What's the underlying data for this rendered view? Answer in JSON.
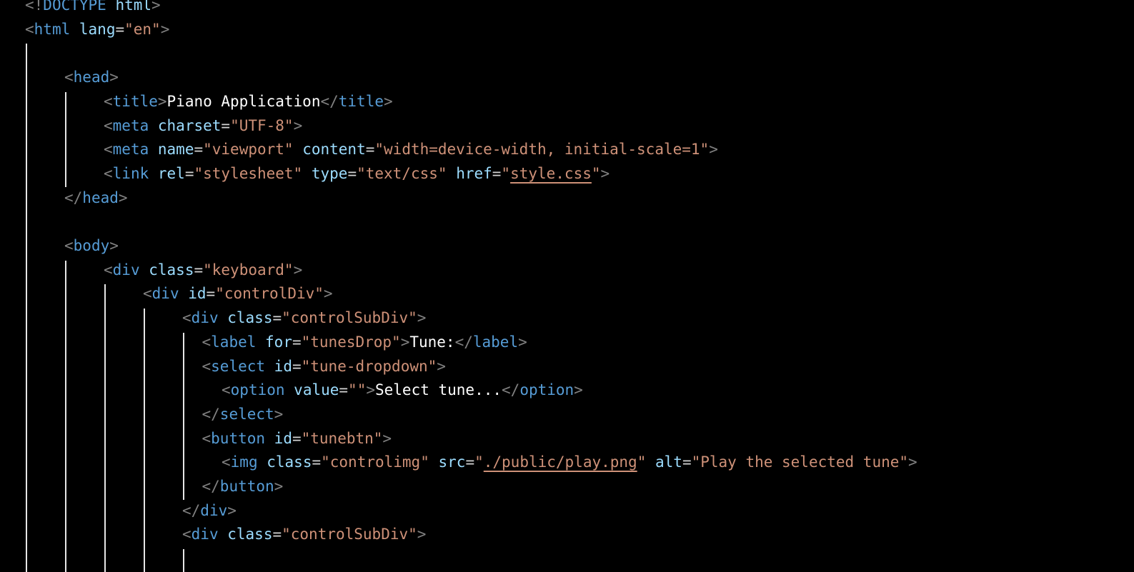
{
  "editor": {
    "theme": {
      "background": "#000000",
      "bracket": "#808080",
      "tag": "#569cd6",
      "attribute": "#9cdcfe",
      "string": "#ce9178",
      "text": "#ffffff"
    },
    "lines": [
      {
        "indent": 0,
        "tokens": [
          [
            "bracket",
            "<!"
          ],
          [
            "tag",
            "DOCTYPE"
          ],
          [
            "text",
            " "
          ],
          [
            "attr",
            "html"
          ],
          [
            "bracket",
            ">"
          ]
        ]
      },
      {
        "indent": 0,
        "tokens": [
          [
            "bracket",
            "<"
          ],
          [
            "tag",
            "html"
          ],
          [
            "text",
            " "
          ],
          [
            "attr",
            "lang"
          ],
          [
            "eq",
            "="
          ],
          [
            "str",
            "\"en\""
          ],
          [
            "bracket",
            ">"
          ]
        ]
      },
      {
        "indent": 0,
        "tokens": []
      },
      {
        "indent": 1,
        "tokens": [
          [
            "bracket",
            "<"
          ],
          [
            "tag",
            "head"
          ],
          [
            "bracket",
            ">"
          ]
        ]
      },
      {
        "indent": 2,
        "tokens": [
          [
            "bracket",
            "<"
          ],
          [
            "tag",
            "title"
          ],
          [
            "bracket",
            ">"
          ],
          [
            "text",
            "Piano Application"
          ],
          [
            "bracket",
            "</"
          ],
          [
            "tag",
            "title"
          ],
          [
            "bracket",
            ">"
          ]
        ]
      },
      {
        "indent": 2,
        "tokens": [
          [
            "bracket",
            "<"
          ],
          [
            "tag",
            "meta"
          ],
          [
            "text",
            " "
          ],
          [
            "attr",
            "charset"
          ],
          [
            "eq",
            "="
          ],
          [
            "str",
            "\"UTF-8\""
          ],
          [
            "bracket",
            ">"
          ]
        ]
      },
      {
        "indent": 2,
        "tokens": [
          [
            "bracket",
            "<"
          ],
          [
            "tag",
            "meta"
          ],
          [
            "text",
            " "
          ],
          [
            "attr",
            "name"
          ],
          [
            "eq",
            "="
          ],
          [
            "str",
            "\"viewport\""
          ],
          [
            "text",
            " "
          ],
          [
            "attr",
            "content"
          ],
          [
            "eq",
            "="
          ],
          [
            "str",
            "\"width=device-width, initial-scale=1\""
          ],
          [
            "bracket",
            ">"
          ]
        ]
      },
      {
        "indent": 2,
        "tokens": [
          [
            "bracket",
            "<"
          ],
          [
            "tag",
            "link"
          ],
          [
            "text",
            " "
          ],
          [
            "attr",
            "rel"
          ],
          [
            "eq",
            "="
          ],
          [
            "str",
            "\"stylesheet\""
          ],
          [
            "text",
            " "
          ],
          [
            "attr",
            "type"
          ],
          [
            "eq",
            "="
          ],
          [
            "str",
            "\"text/css\""
          ],
          [
            "text",
            " "
          ],
          [
            "attr",
            "href"
          ],
          [
            "eq",
            "="
          ],
          [
            "str",
            "\""
          ],
          [
            "link",
            "style.css"
          ],
          [
            "str",
            "\""
          ],
          [
            "bracket",
            ">"
          ]
        ]
      },
      {
        "indent": 1,
        "tokens": [
          [
            "bracket",
            "</"
          ],
          [
            "tag",
            "head"
          ],
          [
            "bracket",
            ">"
          ]
        ]
      },
      {
        "indent": 0,
        "tokens": []
      },
      {
        "indent": 1,
        "tokens": [
          [
            "bracket",
            "<"
          ],
          [
            "tag",
            "body"
          ],
          [
            "bracket",
            ">"
          ]
        ]
      },
      {
        "indent": 2,
        "tokens": [
          [
            "bracket",
            "<"
          ],
          [
            "tag",
            "div"
          ],
          [
            "text",
            " "
          ],
          [
            "attr",
            "class"
          ],
          [
            "eq",
            "="
          ],
          [
            "str",
            "\"keyboard\""
          ],
          [
            "bracket",
            ">"
          ]
        ]
      },
      {
        "indent": 3,
        "tokens": [
          [
            "bracket",
            "<"
          ],
          [
            "tag",
            "div"
          ],
          [
            "text",
            " "
          ],
          [
            "attr",
            "id"
          ],
          [
            "eq",
            "="
          ],
          [
            "str",
            "\"controlDiv\""
          ],
          [
            "bracket",
            ">"
          ]
        ]
      },
      {
        "indent": 4,
        "tokens": [
          [
            "bracket",
            "<"
          ],
          [
            "tag",
            "div"
          ],
          [
            "text",
            " "
          ],
          [
            "attr",
            "class"
          ],
          [
            "eq",
            "="
          ],
          [
            "str",
            "\"controlSubDiv\""
          ],
          [
            "bracket",
            ">"
          ]
        ]
      },
      {
        "indent": 4.5,
        "tokens": [
          [
            "bracket",
            "<"
          ],
          [
            "tag",
            "label"
          ],
          [
            "text",
            " "
          ],
          [
            "attr",
            "for"
          ],
          [
            "eq",
            "="
          ],
          [
            "str",
            "\"tunesDrop\""
          ],
          [
            "bracket",
            ">"
          ],
          [
            "text",
            "Tune:"
          ],
          [
            "bracket",
            "</"
          ],
          [
            "tag",
            "label"
          ],
          [
            "bracket",
            ">"
          ]
        ]
      },
      {
        "indent": 4.5,
        "tokens": [
          [
            "bracket",
            "<"
          ],
          [
            "tag",
            "select"
          ],
          [
            "text",
            " "
          ],
          [
            "attr",
            "id"
          ],
          [
            "eq",
            "="
          ],
          [
            "str",
            "\"tune-dropdown\""
          ],
          [
            "bracket",
            ">"
          ]
        ]
      },
      {
        "indent": 5,
        "tokens": [
          [
            "bracket",
            "<"
          ],
          [
            "tag",
            "option"
          ],
          [
            "text",
            " "
          ],
          [
            "attr",
            "value"
          ],
          [
            "eq",
            "="
          ],
          [
            "str",
            "\"\""
          ],
          [
            "bracket",
            ">"
          ],
          [
            "text",
            "Select tune..."
          ],
          [
            "bracket",
            "</"
          ],
          [
            "tag",
            "option"
          ],
          [
            "bracket",
            ">"
          ]
        ]
      },
      {
        "indent": 4.5,
        "tokens": [
          [
            "bracket",
            "</"
          ],
          [
            "tag",
            "select"
          ],
          [
            "bracket",
            ">"
          ]
        ]
      },
      {
        "indent": 4.5,
        "tokens": [
          [
            "bracket",
            "<"
          ],
          [
            "tag",
            "button"
          ],
          [
            "text",
            " "
          ],
          [
            "attr",
            "id"
          ],
          [
            "eq",
            "="
          ],
          [
            "str",
            "\"tunebtn\""
          ],
          [
            "bracket",
            ">"
          ]
        ]
      },
      {
        "indent": 5,
        "tokens": [
          [
            "bracket",
            "<"
          ],
          [
            "tag",
            "img"
          ],
          [
            "text",
            " "
          ],
          [
            "attr",
            "class"
          ],
          [
            "eq",
            "="
          ],
          [
            "str",
            "\"controlimg\""
          ],
          [
            "text",
            " "
          ],
          [
            "attr",
            "src"
          ],
          [
            "eq",
            "="
          ],
          [
            "str",
            "\""
          ],
          [
            "link",
            "./public/play.png"
          ],
          [
            "str",
            "\""
          ],
          [
            "text",
            " "
          ],
          [
            "attr",
            "alt"
          ],
          [
            "eq",
            "="
          ],
          [
            "str",
            "\"Play the selected tune\""
          ],
          [
            "bracket",
            ">"
          ]
        ]
      },
      {
        "indent": 4.5,
        "tokens": [
          [
            "bracket",
            "</"
          ],
          [
            "tag",
            "button"
          ],
          [
            "bracket",
            ">"
          ]
        ]
      },
      {
        "indent": 4,
        "tokens": [
          [
            "bracket",
            "</"
          ],
          [
            "tag",
            "div"
          ],
          [
            "bracket",
            ">"
          ]
        ]
      },
      {
        "indent": 4,
        "tokens": [
          [
            "bracket",
            "<"
          ],
          [
            "tag",
            "div"
          ],
          [
            "text",
            " "
          ],
          [
            "attr",
            "class"
          ],
          [
            "eq",
            "="
          ],
          [
            "str",
            "\"controlSubDiv\""
          ],
          [
            "bracket",
            ">"
          ]
        ]
      },
      {
        "indent": 4.5,
        "tokens": []
      }
    ]
  }
}
